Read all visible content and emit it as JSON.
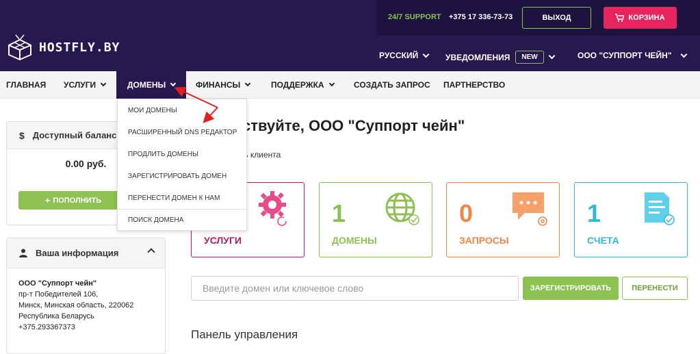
{
  "header": {
    "support": "24/7 SUPPORT",
    "phone": "+375 17 336-73-73",
    "exit_label": "ВЫХОД",
    "cart_label": "КОРЗИНА",
    "logo_text": "HOSTFLY.BY",
    "language": "РУССКИЙ",
    "notifications": "УВЕДОМЛЕНИЯ",
    "notifications_badge": "NEW",
    "account": "ООО \"СУППОРТ ЧЕЙН\""
  },
  "mainnav": {
    "items": [
      {
        "label": "ГЛАВНАЯ"
      },
      {
        "label": "УСЛУГИ"
      },
      {
        "label": "ДОМЕНЫ"
      },
      {
        "label": "ФИНАНСЫ"
      },
      {
        "label": "ПОДДЕРЖКА"
      },
      {
        "label": "СОЗДАТЬ ЗАПРОС"
      },
      {
        "label": "ПАРТНЕРСТВО"
      }
    ]
  },
  "dropdown": {
    "items": [
      {
        "label": "МОИ ДОМЕНЫ"
      },
      {
        "label": "РАСШИРЕННЫЙ DNS РЕДАКТОР"
      },
      {
        "label": "ПРОДЛИТЬ ДОМЕНЫ"
      },
      {
        "label": "ЗАРЕГИСТРИРОВАТЬ ДОМЕН"
      },
      {
        "label": "ПЕРЕНЕСТИ ДОМЕН К НАМ"
      },
      {
        "label": "ПОИСК ДОМЕНА"
      }
    ]
  },
  "sidebar": {
    "balance_title": "Доступный баланс",
    "balance_icon": "dollar-icon",
    "balance_value": "0.00 руб.",
    "topup_label": "ПОПОЛНИТЬ",
    "info_title": "Ваша информация",
    "info_icon": "user-icon",
    "info_lines": [
      "ООО \"Суппорт чейн\"",
      "пр-т Победителей 106,",
      "Минск, Минская область, 220062",
      "Республика Беларусь",
      "+375.293367373"
    ]
  },
  "main": {
    "welcome": "вствуйте, ООО \"Суппорт чейн\"",
    "welcome_sub": "ель клиента",
    "cards": [
      {
        "num": "",
        "label": "УСЛУГИ",
        "color": "#c2185b",
        "icon": "gear-icon"
      },
      {
        "num": "1",
        "label": "ДОМЕНЫ",
        "color": "#8cc152",
        "icon": "globe-icon"
      },
      {
        "num": "0",
        "label": "ЗАПРОСЫ",
        "color": "#f58545",
        "icon": "chat-icon"
      },
      {
        "num": "1",
        "label": "СЧЕТА",
        "color": "#31b7d8",
        "icon": "invoice-icon"
      }
    ],
    "search_placeholder": "Введите домен или ключевое слово",
    "register_label": "ЗАРЕГИСТРИРОВАТЬ",
    "transfer_label": "ПЕРЕНЕСТИ",
    "dashboard_title": "Панель управления"
  },
  "colors": {
    "header_bg": "#25194f",
    "accent_green": "#8cc152",
    "accent_pink": "#e6245e",
    "arrow_red": "#e3211c"
  }
}
